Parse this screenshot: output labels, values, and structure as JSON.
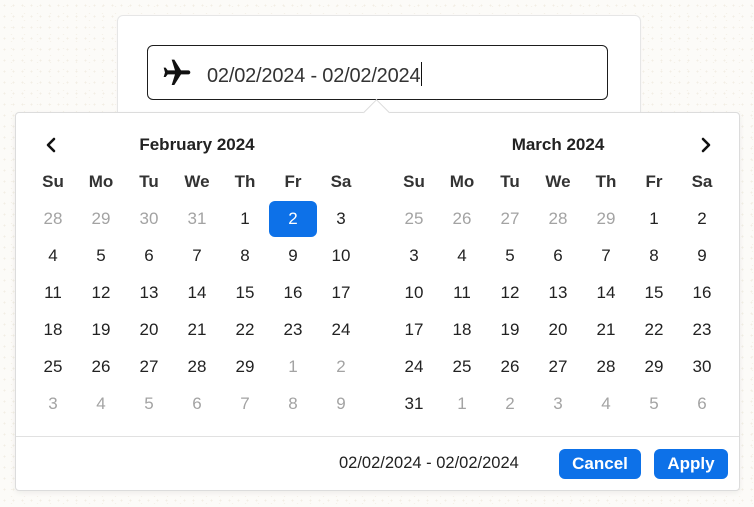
{
  "input": {
    "value": "02/02/2024 - 02/02/2024",
    "icon": "airplane-icon"
  },
  "calendar_left": {
    "title": "February 2024",
    "weekdays": [
      "Su",
      "Mo",
      "Tu",
      "We",
      "Th",
      "Fr",
      "Sa"
    ],
    "weeks": [
      [
        "28",
        "29",
        "30",
        "31",
        "1",
        "2",
        "3"
      ],
      [
        "4",
        "5",
        "6",
        "7",
        "8",
        "9",
        "10"
      ],
      [
        "11",
        "12",
        "13",
        "14",
        "15",
        "16",
        "17"
      ],
      [
        "18",
        "19",
        "20",
        "21",
        "22",
        "23",
        "24"
      ],
      [
        "25",
        "26",
        "27",
        "28",
        "29",
        "1",
        "2"
      ],
      [
        "3",
        "4",
        "5",
        "6",
        "7",
        "8",
        "9"
      ]
    ],
    "muted": [
      [
        0,
        0
      ],
      [
        0,
        1
      ],
      [
        0,
        2
      ],
      [
        0,
        3
      ],
      [
        4,
        5
      ],
      [
        4,
        6
      ],
      [
        5,
        0
      ],
      [
        5,
        1
      ],
      [
        5,
        2
      ],
      [
        5,
        3
      ],
      [
        5,
        4
      ],
      [
        5,
        5
      ],
      [
        5,
        6
      ]
    ],
    "selected": [
      [
        0,
        5
      ]
    ],
    "prev_icon": "chevron-left-icon"
  },
  "calendar_right": {
    "title": "March 2024",
    "weekdays": [
      "Su",
      "Mo",
      "Tu",
      "We",
      "Th",
      "Fr",
      "Sa"
    ],
    "weeks": [
      [
        "25",
        "26",
        "27",
        "28",
        "29",
        "1",
        "2"
      ],
      [
        "3",
        "4",
        "5",
        "6",
        "7",
        "8",
        "9"
      ],
      [
        "10",
        "11",
        "12",
        "13",
        "14",
        "15",
        "16"
      ],
      [
        "17",
        "18",
        "19",
        "20",
        "21",
        "22",
        "23"
      ],
      [
        "24",
        "25",
        "26",
        "27",
        "28",
        "29",
        "30"
      ],
      [
        "31",
        "1",
        "2",
        "3",
        "4",
        "5",
        "6"
      ]
    ],
    "muted": [
      [
        0,
        0
      ],
      [
        0,
        1
      ],
      [
        0,
        2
      ],
      [
        0,
        3
      ],
      [
        0,
        4
      ],
      [
        5,
        1
      ],
      [
        5,
        2
      ],
      [
        5,
        3
      ],
      [
        5,
        4
      ],
      [
        5,
        5
      ],
      [
        5,
        6
      ]
    ],
    "selected": [],
    "next_icon": "chevron-right-icon"
  },
  "footer": {
    "range_text": "02/02/2024 - 02/02/2024",
    "cancel_label": "Cancel",
    "apply_label": "Apply"
  },
  "colors": {
    "accent": "#0d71e8",
    "muted_text": "#a3a3a3"
  }
}
